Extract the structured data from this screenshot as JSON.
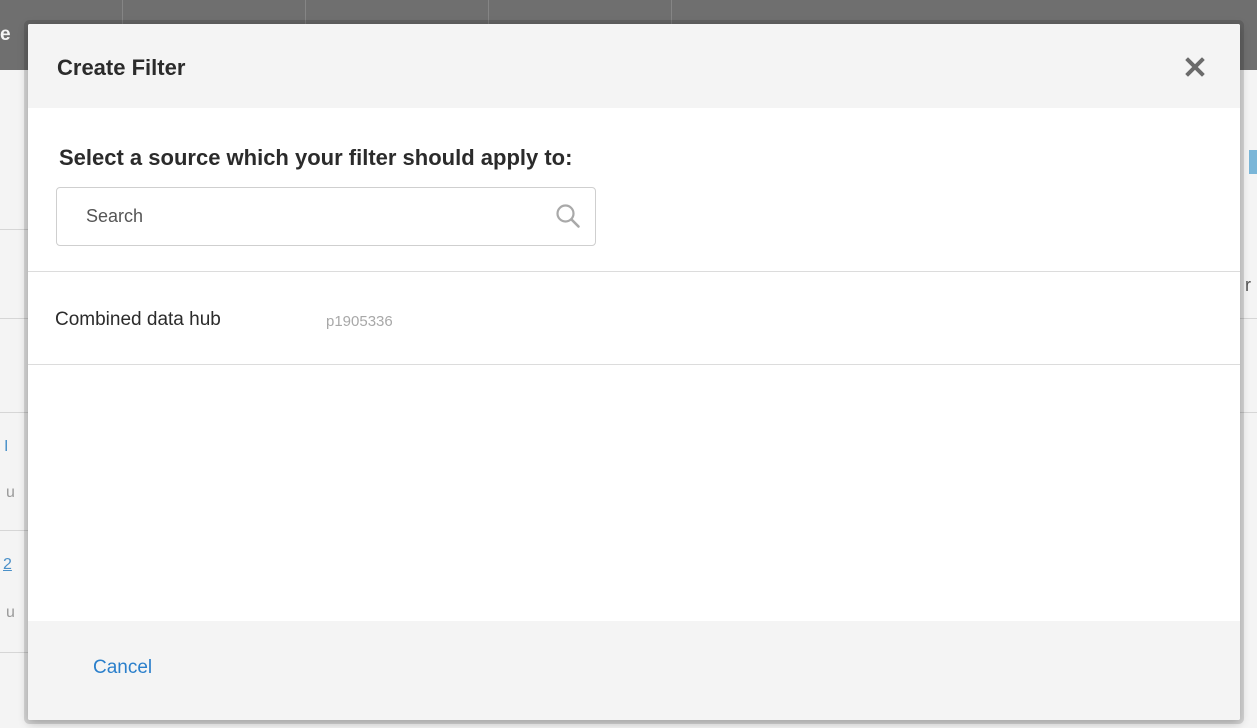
{
  "background": {
    "header_fragment": "e",
    "fragments": [
      "r",
      "I",
      "u",
      "2",
      "u"
    ]
  },
  "modal": {
    "title": "Create Filter",
    "close_icon": "close-icon",
    "prompt": "Select a source which your filter should apply to:",
    "search": {
      "placeholder": "Search",
      "value": "",
      "icon": "search-icon"
    },
    "sources": [
      {
        "name": "Combined data hub",
        "id": "p1905336"
      }
    ],
    "footer": {
      "cancel_label": "Cancel"
    }
  },
  "colors": {
    "link": "#2a7fcb",
    "title_text": "#2b2b2b",
    "secondary_text": "#a8a8a8",
    "header_bg": "#f4f4f4",
    "overlay_header": "#6f6f6f"
  }
}
